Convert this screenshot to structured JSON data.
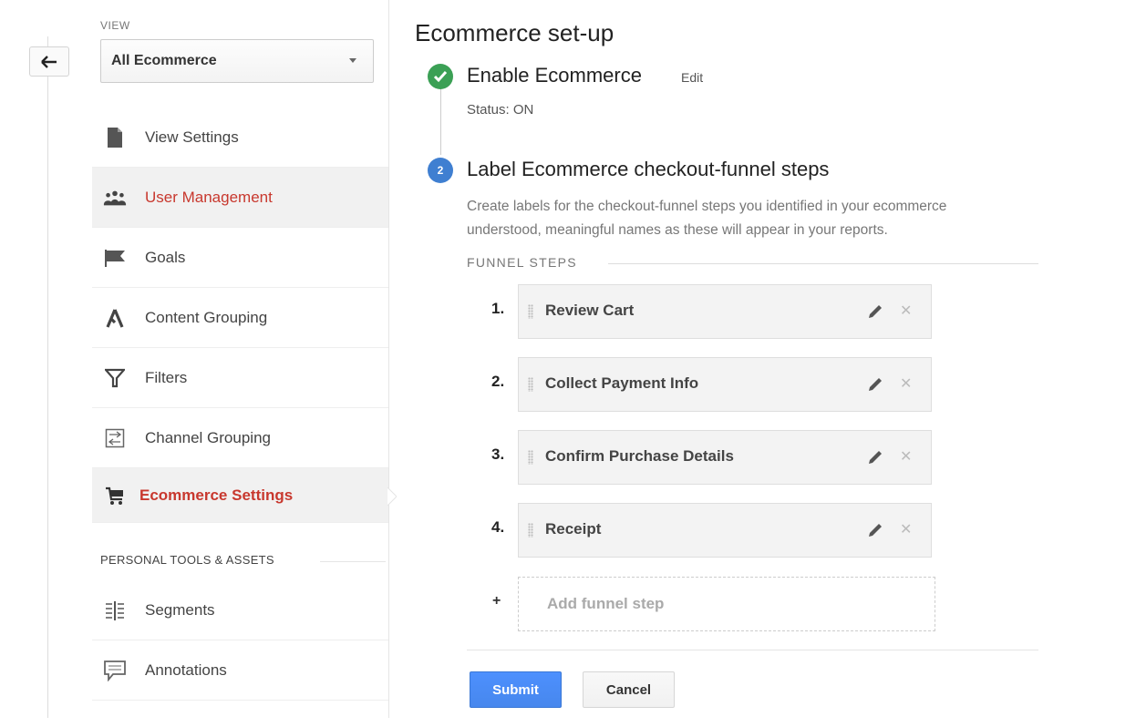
{
  "sidebar": {
    "view_label": "VIEW",
    "view_selected": "All Ecommerce",
    "items": [
      {
        "label": "View Settings",
        "icon": "document-icon"
      },
      {
        "label": "User Management",
        "icon": "users-icon"
      },
      {
        "label": "Goals",
        "icon": "flag-icon"
      },
      {
        "label": "Content Grouping",
        "icon": "content-grouping-icon"
      },
      {
        "label": "Filters",
        "icon": "filter-icon"
      },
      {
        "label": "Channel Grouping",
        "icon": "channel-grouping-icon"
      },
      {
        "label": "Ecommerce Settings",
        "icon": "cart-icon"
      }
    ],
    "personal_section_title": "PERSONAL TOOLS & ASSETS",
    "personal_items": [
      {
        "label": "Segments",
        "icon": "segments-icon"
      },
      {
        "label": "Annotations",
        "icon": "annotation-icon"
      }
    ]
  },
  "main": {
    "title": "Ecommerce set-up",
    "step1": {
      "title": "Enable Ecommerce",
      "edit": "Edit",
      "status": "Status: ON"
    },
    "step2": {
      "badge": "2",
      "title": "Label Ecommerce checkout-funnel steps",
      "desc_line1": "Create labels for the checkout-funnel steps you identified in your ecommerce",
      "desc_line2": "understood, meaningful names as these will appear in your reports."
    },
    "funnel_label": "FUNNEL STEPS",
    "funnel_steps": [
      {
        "num": "1.",
        "name": "Review Cart"
      },
      {
        "num": "2.",
        "name": "Collect Payment Info"
      },
      {
        "num": "3.",
        "name": "Confirm Purchase Details"
      },
      {
        "num": "4.",
        "name": "Receipt"
      }
    ],
    "add_plus": "+",
    "add_step_placeholder": "Add funnel step",
    "submit_label": "Submit",
    "cancel_label": "Cancel"
  },
  "colors": {
    "accent_red": "#c8382e",
    "success_green": "#3ba055",
    "primary_blue": "#4d90fe"
  }
}
